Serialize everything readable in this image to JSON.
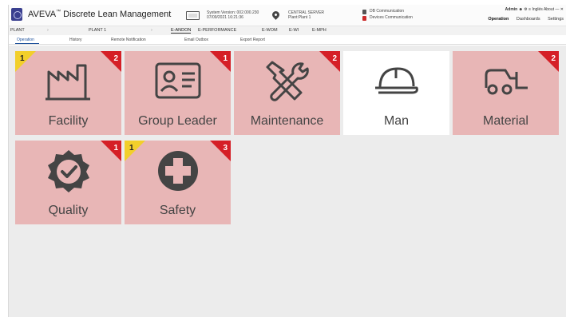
{
  "header": {
    "app_name": "AVEVA",
    "app_trademark": "™",
    "app_product": " Discrete Lean Management",
    "system_version_line": "System Version: 002.000.230",
    "system_time_line": "07/09/2021 16:21:36",
    "server_line1": "CENTRAL SERVER",
    "server_line2": "Plant:Plant 1",
    "db_comm": "DB Communication",
    "devices_comm": "Devices Communication",
    "user": "Admin",
    "lang": "Inglés",
    "about": "About",
    "nav": [
      "Operation",
      "Dashboards",
      "Settings"
    ]
  },
  "plantbar": {
    "plant_label": "PLANT",
    "sep1": "›",
    "plant_value": "PLANT 1",
    "sep2": "›",
    "modules": [
      "E-ANDON",
      "E-PERFORMANCE",
      "E-WOM",
      "E-WI",
      "E-MPH"
    ]
  },
  "subtabs": [
    "Operation",
    "History",
    "Remote Notification",
    "Email Outbox",
    "Export Report"
  ],
  "tiles": [
    {
      "label": "Facility",
      "icon": "factory-icon",
      "yellow_count": "1",
      "red_count": "2"
    },
    {
      "label": "Group Leader",
      "icon": "id-card-icon",
      "yellow_count": "",
      "red_count": "1"
    },
    {
      "label": "Maintenance",
      "icon": "tools-icon",
      "yellow_count": "",
      "red_count": "2"
    },
    {
      "label": "Man",
      "icon": "helmet-icon",
      "yellow_count": "",
      "red_count": ""
    },
    {
      "label": "Material",
      "icon": "forklift-icon",
      "yellow_count": "",
      "red_count": "2"
    },
    {
      "label": "Quality",
      "icon": "quality-badge-icon",
      "yellow_count": "",
      "red_count": "1"
    },
    {
      "label": "Safety",
      "icon": "safety-cross-icon",
      "yellow_count": "1",
      "red_count": "3"
    }
  ],
  "colors": {
    "alarm_tile": "#e8b6b6",
    "normal_tile": "#ffffff",
    "red_flag": "#d51f26",
    "yellow_flag": "#f2cf2b",
    "accent": "#1b4f9a"
  }
}
